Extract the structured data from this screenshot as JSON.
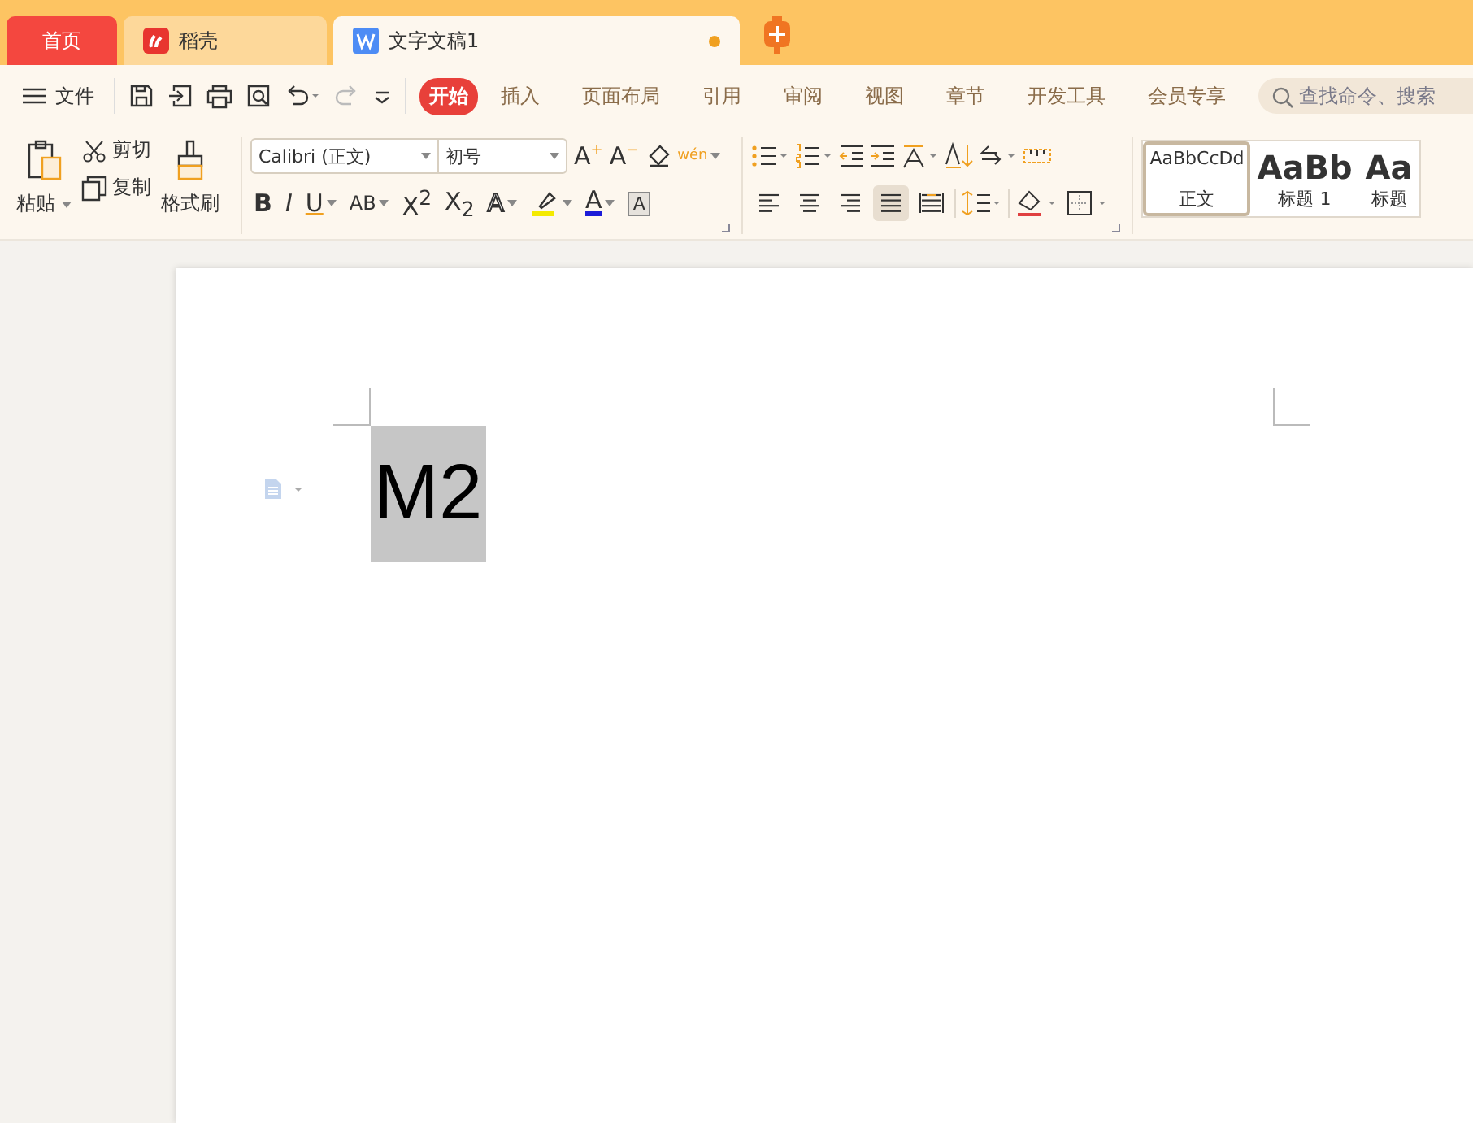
{
  "tabs": [
    {
      "label": "首页",
      "kind": "home",
      "selected": false
    },
    {
      "label": "稻壳",
      "kind": "docer",
      "selected": false
    },
    {
      "label": "文字文稿1",
      "kind": "doc",
      "selected": true,
      "unsaved": true
    }
  ],
  "menu": {
    "file": "文件",
    "ribbon_tabs": [
      {
        "label": "开始",
        "selected": true
      },
      {
        "label": "插入",
        "selected": false
      },
      {
        "label": "页面布局",
        "selected": false
      },
      {
        "label": "引用",
        "selected": false
      },
      {
        "label": "审阅",
        "selected": false
      },
      {
        "label": "视图",
        "selected": false
      },
      {
        "label": "章节",
        "selected": false
      },
      {
        "label": "开发工具",
        "selected": false
      },
      {
        "label": "会员专享",
        "selected": false
      }
    ],
    "search": {
      "placeholder": "查找命令、搜索"
    }
  },
  "clipboard": {
    "paste": "粘贴",
    "cut": "剪切",
    "copy": "复制",
    "format_painter": "格式刷"
  },
  "font": {
    "name": "Calibri (正文)",
    "size": "初号",
    "pinyin": "wén",
    "size_buttons": [
      "A$^{+}$",
      "A$^{−}$"
    ],
    "format_buttons": [
      {
        "kind": "bold",
        "text": "B",
        "dropdown": false
      },
      {
        "kind": "italic",
        "text": "I",
        "dropdown": false
      },
      {
        "kind": "underline",
        "text": "U",
        "dropdown": true
      },
      {
        "kind": "emphasis",
        "text": "AB",
        "dropdown": true
      },
      {
        "kind": "plain",
        "text": "X$^{2}$",
        "dropdown": false
      },
      {
        "kind": "plain",
        "text": "X$_{2}$",
        "dropdown": false
      },
      {
        "kind": "outline",
        "text": "A",
        "dropdown": true
      },
      {
        "kind": "highlight",
        "dropdown": true
      },
      {
        "kind": "color",
        "text": "A",
        "dropdown": true
      },
      {
        "kind": "border",
        "text": "A",
        "dropdown": false
      }
    ]
  },
  "paragraph": {
    "alignment": [
      {
        "kind": "left",
        "selected": false
      },
      {
        "kind": "center",
        "selected": false
      },
      {
        "kind": "right",
        "selected": false
      },
      {
        "kind": "justify",
        "selected": true
      },
      {
        "kind": "distributed",
        "selected": false
      }
    ]
  },
  "styles": [
    {
      "preview": "AaBbCcDd",
      "name": "正文",
      "kind": "normal",
      "selected": true
    },
    {
      "preview": "AaBb",
      "name": "标题 1",
      "kind": "heading",
      "selected": false
    },
    {
      "preview": "Aa",
      "name": "标题",
      "kind": "heading",
      "selected": false
    }
  ],
  "document": {
    "text": "M2",
    "selected": true
  }
}
